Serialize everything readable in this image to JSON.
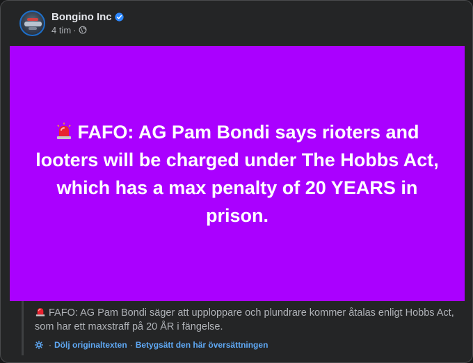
{
  "post": {
    "author": "Bongino Inc",
    "timestamp": "4 tim",
    "separator": "·",
    "image_text": "FAFO: AG Pam Bondi says rioters and looters will be charged under The Hobbs Act, which has a max penalty of 20 YEARS in prison.",
    "image_bg": "#aa00ff"
  },
  "translation": {
    "text": "FAFO: AG Pam Bondi säger att upploppare och plundrare kommer åtalas enligt Hobbs Act, som har ett maxstraff på 20 ÅR i fängelse.",
    "hide_original_label": "Dölj originaltexten",
    "rate_label": "Betygsätt den här översättningen",
    "link_separator": "·"
  },
  "colors": {
    "card_bg": "#242526",
    "link": "#5fa9f5",
    "verified": "#2d88ff"
  }
}
